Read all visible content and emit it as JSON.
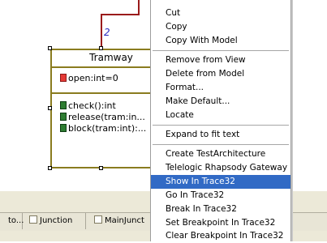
{
  "diagram": {
    "link_label": "2",
    "class_name": "Tramway",
    "attributes": [
      "open:int=0"
    ],
    "operations": [
      "check():int",
      "release(tram:in...",
      "block(tram:int):..."
    ]
  },
  "tabs": [
    {
      "label": "to..."
    },
    {
      "label": "Junction"
    },
    {
      "label": "MainJunct"
    }
  ],
  "context_menu": {
    "groups": [
      [
        "Cut",
        "Copy",
        "Copy With Model"
      ],
      [
        "Remove from View",
        "Delete from Model",
        "Format...",
        "Make Default...",
        "Locate"
      ],
      [
        "Expand to fit text"
      ],
      [
        "Create TestArchitecture",
        "Telelogic Rhapsody Gateway",
        "Show In Trace32",
        "Go In Trace32",
        "Break In Trace32",
        "Set Breakpoint In Trace32",
        "Clear Breakpoint In Trace32"
      ]
    ],
    "highlighted": "Show In Trace32"
  }
}
